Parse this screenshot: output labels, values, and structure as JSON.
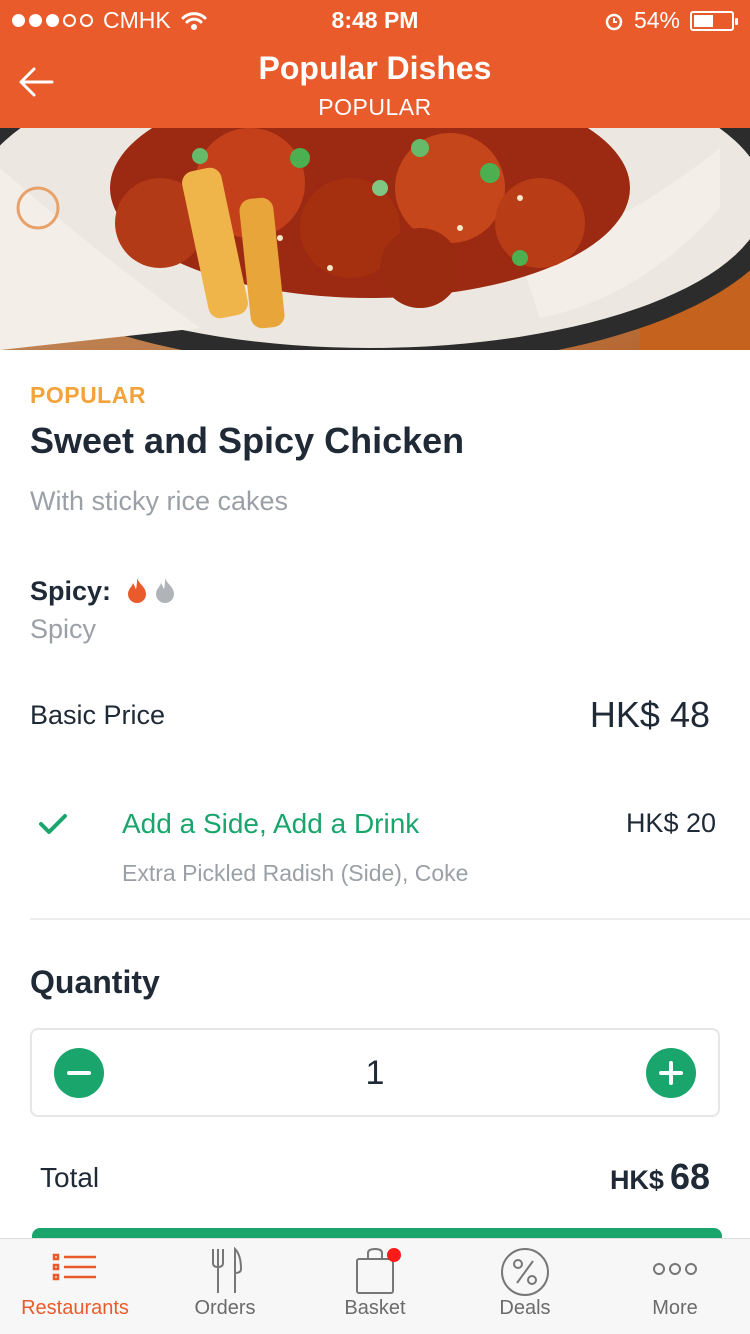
{
  "status_bar": {
    "carrier": "CMHK",
    "time": "8:48 PM",
    "battery": "54%",
    "battery_level": 0.54
  },
  "header": {
    "title": "Popular Dishes",
    "subtitle": "POPULAR",
    "back_icon": "arrow-left-icon"
  },
  "dish": {
    "tag": "POPULAR",
    "name": "Sweet and Spicy Chicken",
    "description": "With sticky rice cakes",
    "spicy_label": "Spicy:",
    "spicy_value": "Spicy",
    "spicy_level": 1,
    "spicy_max": 2
  },
  "pricing": {
    "basic_label": "Basic Price",
    "basic_value": "HK$ 48"
  },
  "addon": {
    "name": "Add a Side, Add a Drink",
    "price": "HK$ 20",
    "detail": "Extra Pickled Radish (Side), Coke",
    "checked": true
  },
  "quantity": {
    "title": "Quantity",
    "value": "1"
  },
  "total": {
    "label": "Total",
    "currency": "HK$",
    "amount": "68"
  },
  "tabs": [
    {
      "label": "Restaurants",
      "icon": "list-icon",
      "active": true
    },
    {
      "label": "Orders",
      "icon": "fork-knife-icon",
      "active": false
    },
    {
      "label": "Basket",
      "icon": "bag-icon",
      "active": false
    },
    {
      "label": "Deals",
      "icon": "percent-icon",
      "active": false
    },
    {
      "label": "More",
      "icon": "more-dots-icon",
      "active": false
    }
  ],
  "colors": {
    "brand": "#ea5b2c",
    "accent_green": "#1aa56c",
    "tag_orange": "#f3a33b",
    "muted_text": "#9aa0a6"
  }
}
